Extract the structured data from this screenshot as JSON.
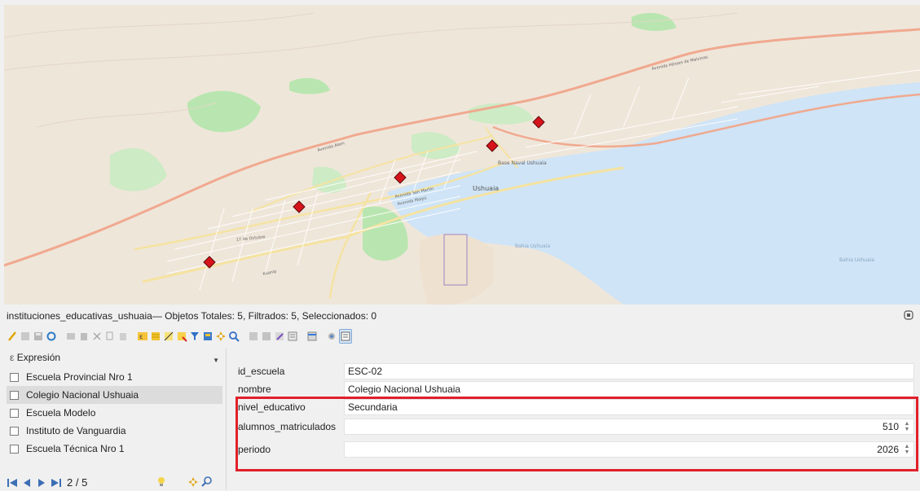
{
  "layer_title": "instituciones_educativas_ushuaia— Objetos Totales: 5, Filtrados: 5, Seleccionados: 0",
  "map": {
    "place_label": "Ushuaia",
    "bay_label_1": "Bahia Ushuaia",
    "bay_label_2": "Bahia Ushuaia",
    "naval_label": "Base Naval Ushuaia",
    "street_labels": [
      "Avenida Héroes de Malvinas",
      "Avenida San Martín",
      "Avenida Maipú",
      "17 de Octubre",
      "Kuanip",
      "Avenida Alem"
    ],
    "colors": {
      "land": "#efe6da",
      "water": "#cfe4f6",
      "park": "#b9e6b0",
      "road_major": "#f0a98f",
      "road_secondary": "#f5e3a1",
      "marker": "#d7141b"
    },
    "markers": [
      "Escuela Provincial Nro 1",
      "Colegio Nacional Ushuaia",
      "Escuela Modelo",
      "Instituto de Vanguardia",
      "Escuela Técnica Nro 1"
    ]
  },
  "left_panel": {
    "expression_label": "Expresión",
    "features": [
      {
        "label": "Escuela Provincial Nro 1",
        "selected": false
      },
      {
        "label": "Colegio Nacional Ushuaia",
        "selected": true
      },
      {
        "label": "Escuela Modelo",
        "selected": false
      },
      {
        "label": "Instituto de Vanguardia",
        "selected": false
      },
      {
        "label": "Escuela Técnica Nro 1",
        "selected": false
      }
    ],
    "nav_count": "2 / 5"
  },
  "form": {
    "fields": [
      {
        "label": "id_escuela",
        "value": "ESC-02"
      },
      {
        "label": "nombre",
        "value": "Colegio Nacional Ushuaia"
      },
      {
        "label": "nivel_educativo",
        "value": "Secundaria"
      },
      {
        "label": "alumnos_matriculados",
        "value": "510"
      },
      {
        "label": "periodo",
        "value": "2026"
      }
    ]
  },
  "toolbar_icons": [
    "edit-pencil-icon",
    "multi-edit-icon",
    "save-icon",
    "reload-icon",
    "add-feature-icon",
    "delete-icon",
    "cut-icon",
    "copy-icon",
    "paste-icon",
    "expression-select-icon",
    "select-all-icon",
    "invert-selection-icon",
    "deselect-icon",
    "filter-icon",
    "move-selection-top-icon",
    "pan-to-icon",
    "zoom-to-icon",
    "new-field-icon",
    "delete-field-icon",
    "field-calculator-icon",
    "conditional-format-icon",
    "dock-icon",
    "actions-icon",
    "form-view-icon"
  ],
  "highlight_color": "#e0202a"
}
